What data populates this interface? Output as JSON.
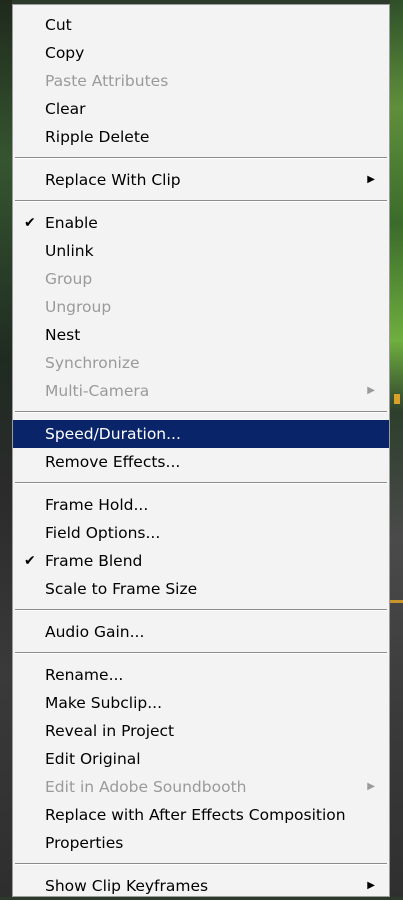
{
  "menu": {
    "cut": "Cut",
    "copy": "Copy",
    "paste_attributes": "Paste Attributes",
    "clear": "Clear",
    "ripple_delete": "Ripple Delete",
    "replace_with_clip": "Replace With Clip",
    "enable": "Enable",
    "unlink": "Unlink",
    "group": "Group",
    "ungroup": "Ungroup",
    "nest": "Nest",
    "synchronize": "Synchronize",
    "multi_camera": "Multi-Camera",
    "speed_duration": "Speed/Duration...",
    "remove_effects": "Remove Effects...",
    "frame_hold": "Frame Hold...",
    "field_options": "Field Options...",
    "frame_blend": "Frame Blend",
    "scale_to_frame_size": "Scale to Frame Size",
    "audio_gain": "Audio Gain...",
    "rename": "Rename...",
    "make_subclip": "Make Subclip...",
    "reveal_in_project": "Reveal in Project",
    "edit_original": "Edit Original",
    "edit_in_soundbooth": "Edit in Adobe Soundbooth",
    "replace_with_ae": "Replace with After Effects Composition",
    "properties": "Properties",
    "show_clip_keyframes": "Show Clip Keyframes"
  },
  "glyphs": {
    "check": "✔",
    "submenu_arrow": "▶"
  },
  "colors": {
    "highlight": "#0a246a",
    "disabled_text": "#9a9a9a",
    "menu_bg": "#f3f3f3"
  }
}
